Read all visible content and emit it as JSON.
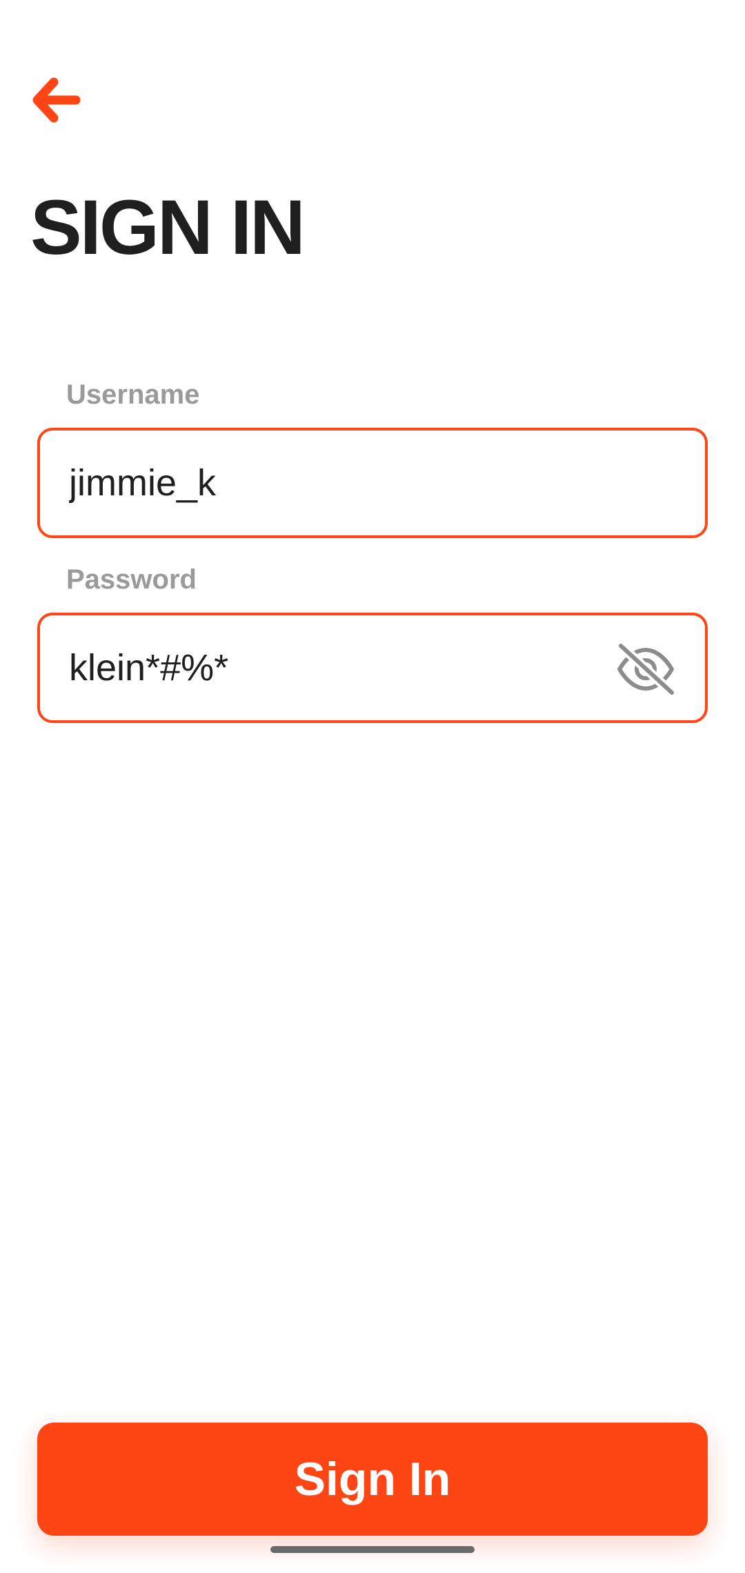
{
  "header": {
    "back_icon": "arrow-left-icon",
    "title": "SIGN IN"
  },
  "form": {
    "username": {
      "label": "Username",
      "value": "jimmie_k"
    },
    "password": {
      "label": "Password",
      "value": "klein*#%*",
      "visibility_icon": "eye-off-icon"
    }
  },
  "actions": {
    "submit_label": "Sign In"
  },
  "colors": {
    "accent": "#ff4514",
    "title_text": "#1f1f1f",
    "label_text": "#9a9a9a",
    "icon_gray": "#8c8c8c"
  }
}
